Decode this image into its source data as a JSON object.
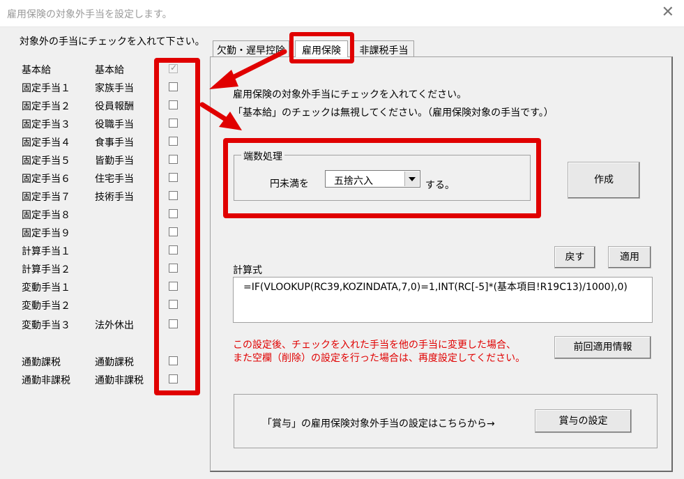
{
  "window": {
    "title": "雇用保険の対象外手当を設定します。",
    "close_glyph": "✕"
  },
  "instruction": "対象外の手当にチェックを入れて下さい。",
  "allowances": [
    {
      "code": "基本給",
      "name": "基本給",
      "checked": true
    },
    {
      "code": "固定手当１",
      "name": "家族手当",
      "checked": false
    },
    {
      "code": "固定手当２",
      "name": "役員報酬",
      "checked": false
    },
    {
      "code": "固定手当３",
      "name": "役職手当",
      "checked": false
    },
    {
      "code": "固定手当４",
      "name": "食事手当",
      "checked": false
    },
    {
      "code": "固定手当５",
      "name": "皆勤手当",
      "checked": false
    },
    {
      "code": "固定手当６",
      "name": "住宅手当",
      "checked": false
    },
    {
      "code": "固定手当７",
      "name": "技術手当",
      "checked": false
    },
    {
      "code": "固定手当８",
      "name": "",
      "checked": false
    },
    {
      "code": "固定手当９",
      "name": "",
      "checked": false
    },
    {
      "code": "計算手当１",
      "name": "",
      "checked": false
    },
    {
      "code": "計算手当２",
      "name": "",
      "checked": false
    },
    {
      "code": "変動手当１",
      "name": "",
      "checked": false
    },
    {
      "code": "変動手当２",
      "name": "",
      "checked": false
    },
    {
      "code": "変動手当３",
      "name": "法外休出",
      "checked": false
    },
    {
      "code": "通勤課税",
      "name": "通勤課税",
      "checked": false
    },
    {
      "code": "通勤非課税",
      "name": "通勤非課税",
      "checked": false
    }
  ],
  "tabs": [
    {
      "label": "欠勤・遅早控除",
      "active": false
    },
    {
      "label": "雇用保険",
      "active": true
    },
    {
      "label": "非課税手当",
      "active": false
    }
  ],
  "panel": {
    "note1": "雇用保険の対象外手当にチェックを入れてください。",
    "note2": "「基本給」のチェックは無視してください。（雇用保険対象の手当です。）",
    "rounding": {
      "legend": "端数処理",
      "prefix": "円未満を",
      "selected": "五捨六入",
      "suffix": "する。"
    },
    "create_button": "作成",
    "back_button": "戻す",
    "apply_button": "適用",
    "formula_label": "計算式",
    "formula": "=IF(VLOOKUP(RC39,KOZINDATA,7,0)=1,INT(RC[-5]*(基本項目!R19C13)/1000),0)",
    "warning1": "この設定後、チェックを入れた手当を他の手当に変更した場合、",
    "warning2": "また空欄（削除）の設定を行った場合は、再度設定してください。",
    "prev_info_button": "前回適用情報",
    "bonus_text": "「賞与」の雇用保険対象外手当の設定はこちらから→",
    "bonus_button": "賞与の設定"
  },
  "colors": {
    "highlight": "#e00000",
    "background": "#f0f0f0"
  }
}
